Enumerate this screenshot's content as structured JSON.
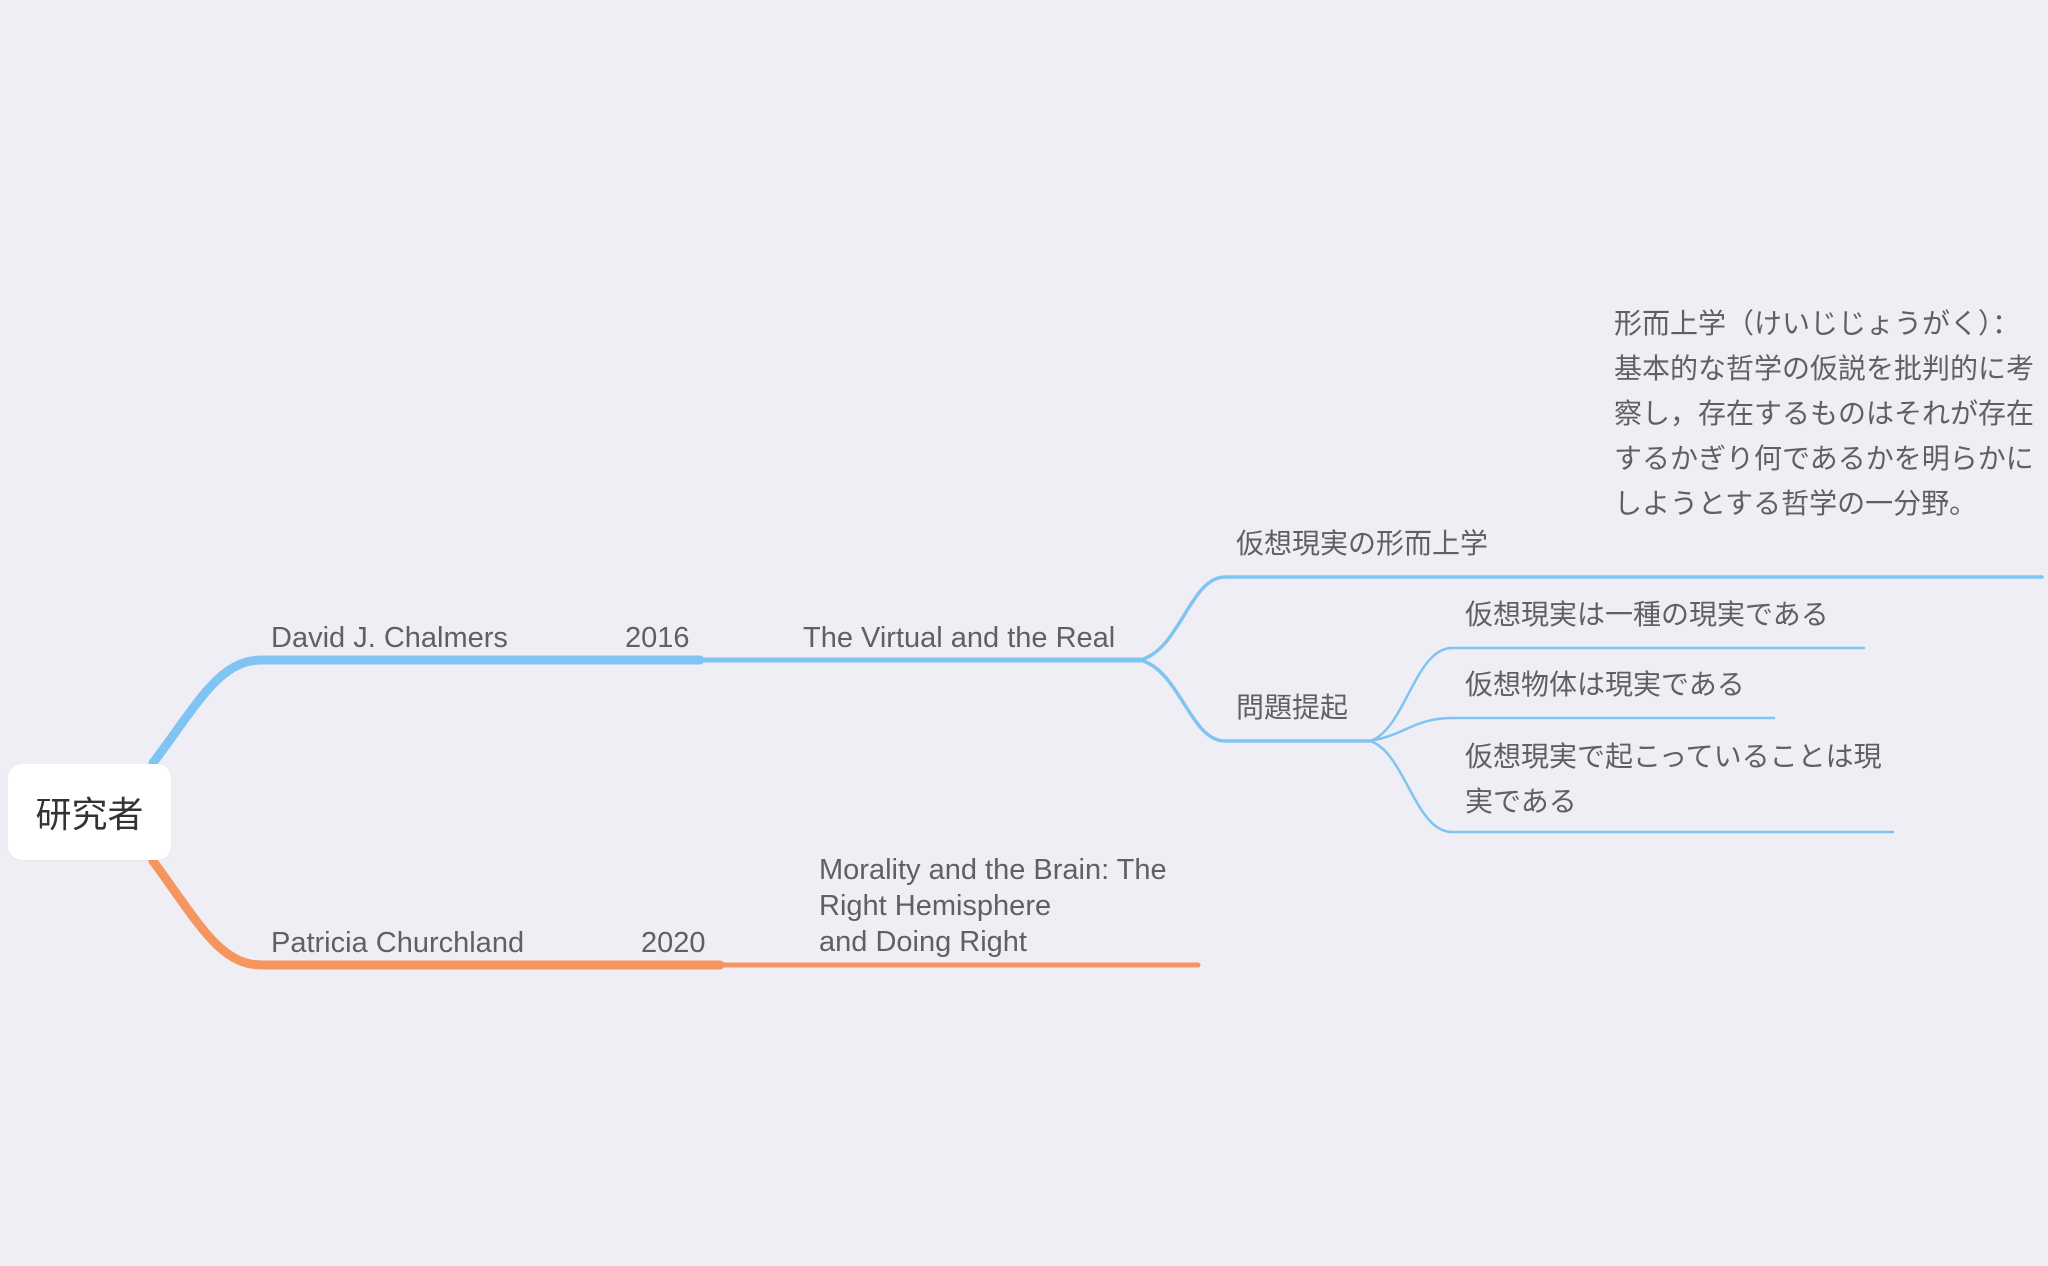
{
  "root": {
    "label": "研究者"
  },
  "branches": [
    {
      "color": "#80c4f3",
      "researcher": "David J. Chalmers",
      "year": "2016",
      "work": "The Virtual and the Real",
      "topics": [
        {
          "label": "仮想現実の形而上学",
          "note": "形而上学（けいじじょうがく）：基本的な哲学の仮説を批判的に考察し，存在するものはそれが存在するかぎり何であるかを明らかにしようとする哲学の一分野。"
        },
        {
          "label": "問題提起",
          "items": [
            "仮想現実は一種の現実である",
            "仮想物体は現実である",
            "仮想現実で起こっていることは現実である"
          ]
        }
      ]
    },
    {
      "color": "#f5955f",
      "researcher": "Patricia Churchland",
      "year": "2020",
      "work_lines": [
        "Morality and the Brain: The",
        "Right Hemisphere",
        "and Doing Right"
      ]
    }
  ]
}
